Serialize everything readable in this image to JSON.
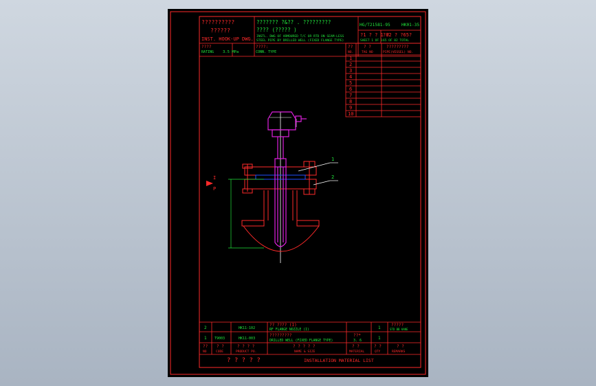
{
  "title_block": {
    "company_l1": "??????????",
    "company_l2": "??????",
    "company_en": "INST. HOOK-UP DWG.",
    "desc_l1": "??????? ?&??     . ?????????",
    "desc_l2": "???? (????? )",
    "desc_en_l1": "INSTL. DWG OF ARMOURED T/C OR RTD ON SEAM-LESS",
    "desc_en_l2": "STEEL PIPE BY DRILLED WELL (FIXED FLANGE TYPE)",
    "code_std": "HG/T21581-95",
    "code_dwg": "HK01-35",
    "sheet_cn": "?1 ? ? 1 ?",
    "sheet_en": "SHEET 1 OF 1",
    "total_cn": "?82 ? ?65?",
    "total_en": "65 OF 82 TOTAL",
    "rating_label": "RATING",
    "rating_value": "3.5 MPa",
    "rating_cn": "????",
    "conn_cn": "????:",
    "conn_en": "CONN. TYPE"
  },
  "tag_table": {
    "headers_cn": [
      "??",
      "? ?",
      "?????????"
    ],
    "headers_en": [
      "NO.",
      "TAG NO",
      "PIPE(VESSEL) NO."
    ],
    "rows": [
      "1",
      "2",
      "3",
      "4",
      "5",
      "6",
      "7",
      "8",
      "9",
      "10"
    ]
  },
  "drawing": {
    "balloon_1": "1",
    "balloon_2": "2",
    "section_label": "I",
    "section_label_p": "P"
  },
  "material_list": {
    "rows": [
      {
        "no": "2",
        "code": "",
        "product": "HK11-102",
        "name_cn": "?? ???? (I)",
        "name_en": "RF FLANGE NOZZLE (I)",
        "material_cn": "",
        "material_en": "",
        "qty": "1",
        "remark_cn": "?????",
        "remark_en": "STD BB KANE"
      },
      {
        "no": "1",
        "code": "T9003",
        "product": "HK11-003",
        "name_cn": "?????????",
        "name_en": "DRILLED WELL (FIXED FLANGE TYPE)",
        "material_cn": "??*",
        "material_en": "3. 6",
        "qty": "1",
        "remark_cn": "",
        "remark_en": ""
      }
    ],
    "headers_cn": [
      "??",
      "? ?",
      "? ? ? ?",
      "? ? ? ? ?",
      "? ?",
      "? ?",
      "? ?"
    ],
    "headers_en": [
      "NO",
      "CODE",
      "PRODUCT PO.",
      "NAME & SIZE",
      "MATERIAL",
      "QTY",
      "REMARKS"
    ],
    "footer_cn": "? ? ? ? ?",
    "footer_en": "INSTALLATION MATERIAL LIST"
  }
}
